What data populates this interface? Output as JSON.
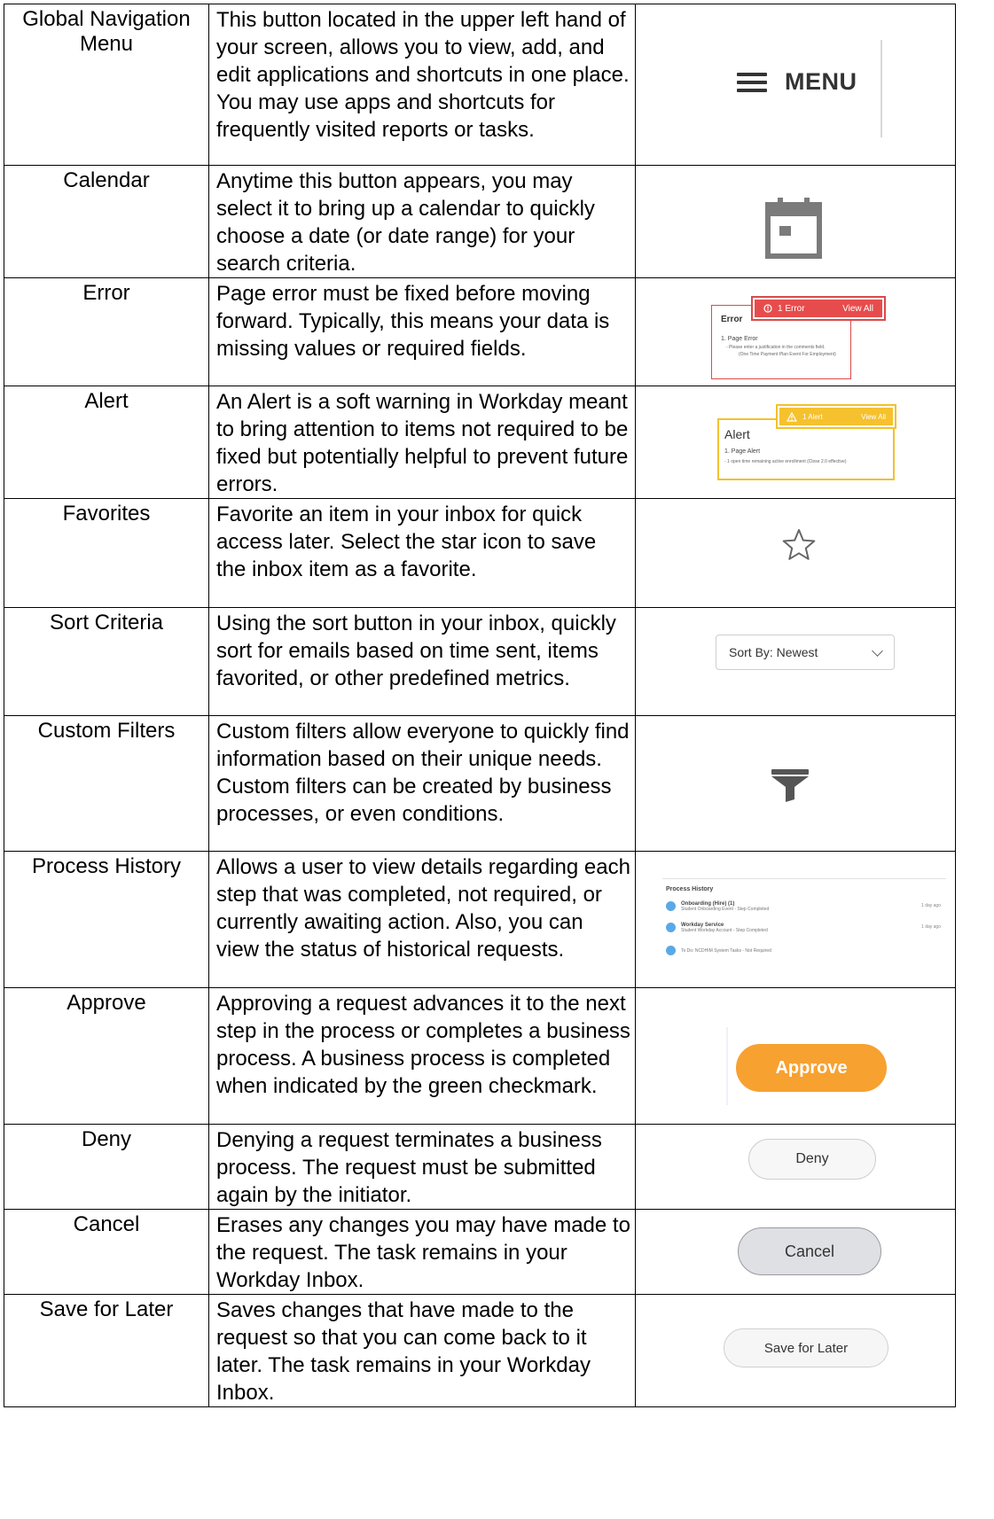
{
  "rows": [
    {
      "term": "Global Navigation Menu",
      "description": "This button located in the upper left hand of your screen, allows you to view, add, and edit applications and shortcuts in one place. You may use apps and shortcuts for frequently visited reports or tasks."
    },
    {
      "term": "Calendar",
      "description": "Anytime this button appears, you may select it to bring up a calendar to quickly choose a date (or date range) for your search criteria."
    },
    {
      "term": "Error",
      "description": "Page error must be fixed before moving forward. Typically, this means your data is missing values or required fields."
    },
    {
      "term": "Alert",
      "description": "An Alert is a soft warning in Workday meant to bring attention to items not required to be fixed but potentially helpful to prevent future errors."
    },
    {
      "term": "Favorites",
      "description": "Favorite an item in your inbox for quick access later. Select the star icon to save the inbox item as a favorite."
    },
    {
      "term": "Sort Criteria",
      "description": "Using the sort button in your inbox, quickly sort for emails based on time sent, items favorited, or other predefined metrics."
    },
    {
      "term": "Custom Filters",
      "description": "Custom filters allow everyone to quickly find information based on their unique needs. Custom filters can be created by business processes, or even conditions."
    },
    {
      "term": "Process History",
      "description": "Allows a user to view details regarding each step that was completed, not required, or currently awaiting action. Also, you can view the status of historical requests."
    },
    {
      "term": "Approve",
      "description": "Approving a request advances it to the next step in the process or completes a business process. A business process is completed when indicated by the green checkmark."
    },
    {
      "term": "Deny",
      "description": "Denying a request terminates a business process. The request must be submitted again by the initiator."
    },
    {
      "term": "Cancel",
      "description": "Erases any changes you may have made to the request. The task remains in your Workday Inbox."
    },
    {
      "term": "Save for Later",
      "description": "Saves changes that have made to the request so that you can come back to it later. The task remains in your Workday Inbox."
    }
  ],
  "samples": {
    "menu_label": "MENU",
    "error": {
      "header_count": "1 Error",
      "header_link": "View All",
      "title": "Error",
      "item": "1. Page Error",
      "detail": "- Please enter a justification in the comments field.",
      "detail2": "(One Time Payment Plan Event For Employment)"
    },
    "alert": {
      "header_count": "1 Alert",
      "header_link": "View All",
      "title": "Alert",
      "item": "1. Page Alert",
      "detail": "- 1 open time remaining active enrollment",
      "detail2": "(Close 2.0 effective)"
    },
    "sort_label": "Sort By: Newest",
    "process_history": {
      "title": "Process History",
      "rows": [
        {
          "name": "Onboarding (Hire) (1)",
          "sub": "Student Onboarding Event - Step Completed",
          "time": "1 day ago"
        },
        {
          "name": "Workday Service",
          "sub": "Student Workday Account - Step Completed",
          "time": "1 day ago"
        },
        {
          "name": "To Do: NCDHIM System Tasks - Not Required",
          "sub": "",
          "time": ""
        }
      ]
    },
    "approve_label": "Approve",
    "deny_label": "Deny",
    "cancel_label": "Cancel",
    "save_later_label": "Save for Later"
  },
  "colors": {
    "approve": "#f7a131",
    "error": "#e74c4c",
    "alert": "#f5c12e",
    "icon_gray": "#7b7b7b"
  }
}
